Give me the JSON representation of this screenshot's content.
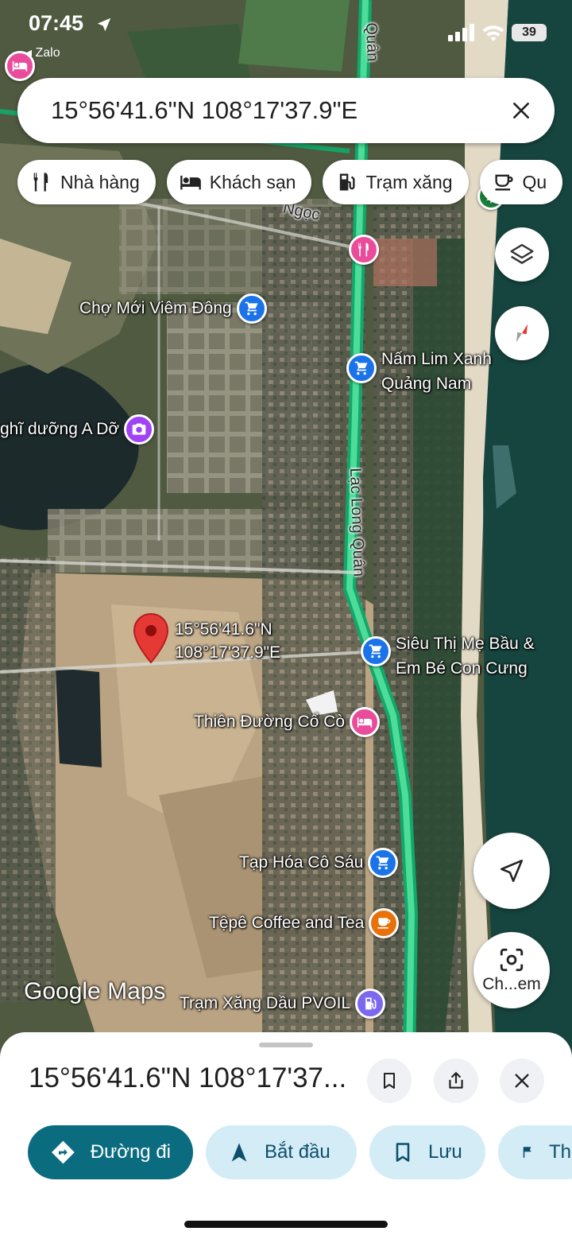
{
  "status": {
    "time": "07:45",
    "back_app": "Zalo",
    "battery": "39"
  },
  "search": {
    "query": "15°56'41.6\"N 108°17'37.9\"E"
  },
  "chips": [
    {
      "label": "Nhà hàng",
      "icon": "restaurant-icon"
    },
    {
      "label": "Khách sạn",
      "icon": "hotel-icon"
    },
    {
      "label": "Trạm xăng",
      "icon": "gas-station-icon"
    },
    {
      "label": "Qu",
      "icon": "coffee-icon"
    }
  ],
  "map": {
    "roads": [
      "Lạc Long Quân",
      "Quân",
      "Ngọc"
    ],
    "pin_label": [
      "15°56'41.6\"N",
      "108°17'37.9\"E"
    ],
    "watermark": "Google Maps",
    "pois": [
      {
        "name": "Chợ Mới Viêm Đông",
        "icon": "shopping-cart-icon",
        "color": "#1a73e8"
      },
      {
        "name_lines": [
          "Nấm Lim Xanh",
          "Quảng Nam"
        ],
        "icon": "shopping-cart-icon",
        "color": "#1a73e8"
      },
      {
        "name": "ghĩ dưỡng A Dỡ",
        "icon": "camera-icon",
        "color": "#a142f4"
      },
      {
        "name_lines": [
          "Siêu Thị Mẹ Bầu &",
          "Em Bé Con Cưng"
        ],
        "icon": "shopping-cart-icon",
        "color": "#1a73e8"
      },
      {
        "name": "Thiên Đường Cổ Cò",
        "icon": "hotel-icon",
        "color": "#e94c9a"
      },
      {
        "name": "Tạp Hóa Cô Sáu",
        "icon": "shopping-cart-icon",
        "color": "#1a73e8"
      },
      {
        "name": "Tệpê Coffee and Tea",
        "icon": "coffee-icon",
        "color": "#e8710a"
      },
      {
        "name": "Trạm Xăng Dầu PVOIL",
        "icon": "gas-station-icon",
        "color": "#7b68ee"
      }
    ],
    "buttons": {
      "layers": "layers-icon",
      "compass": "compass-icon",
      "my_location": "navigation-arrow-icon",
      "lens_label": "Ch...em"
    }
  },
  "sheet": {
    "title": "15°56'41.6\"N 108°17'37...",
    "actions": [
      {
        "label": "Đường đi",
        "icon": "directions-icon"
      },
      {
        "label": "Bắt đầu",
        "icon": "navigation-icon"
      },
      {
        "label": "Lưu",
        "icon": "bookmark-icon"
      },
      {
        "label": "Th",
        "icon": "flag-icon"
      }
    ]
  },
  "colors": {
    "accent": "#0b6c80",
    "chip_bg": "#d3ecf5",
    "route": "#22c47a",
    "pin": "#e53935"
  }
}
